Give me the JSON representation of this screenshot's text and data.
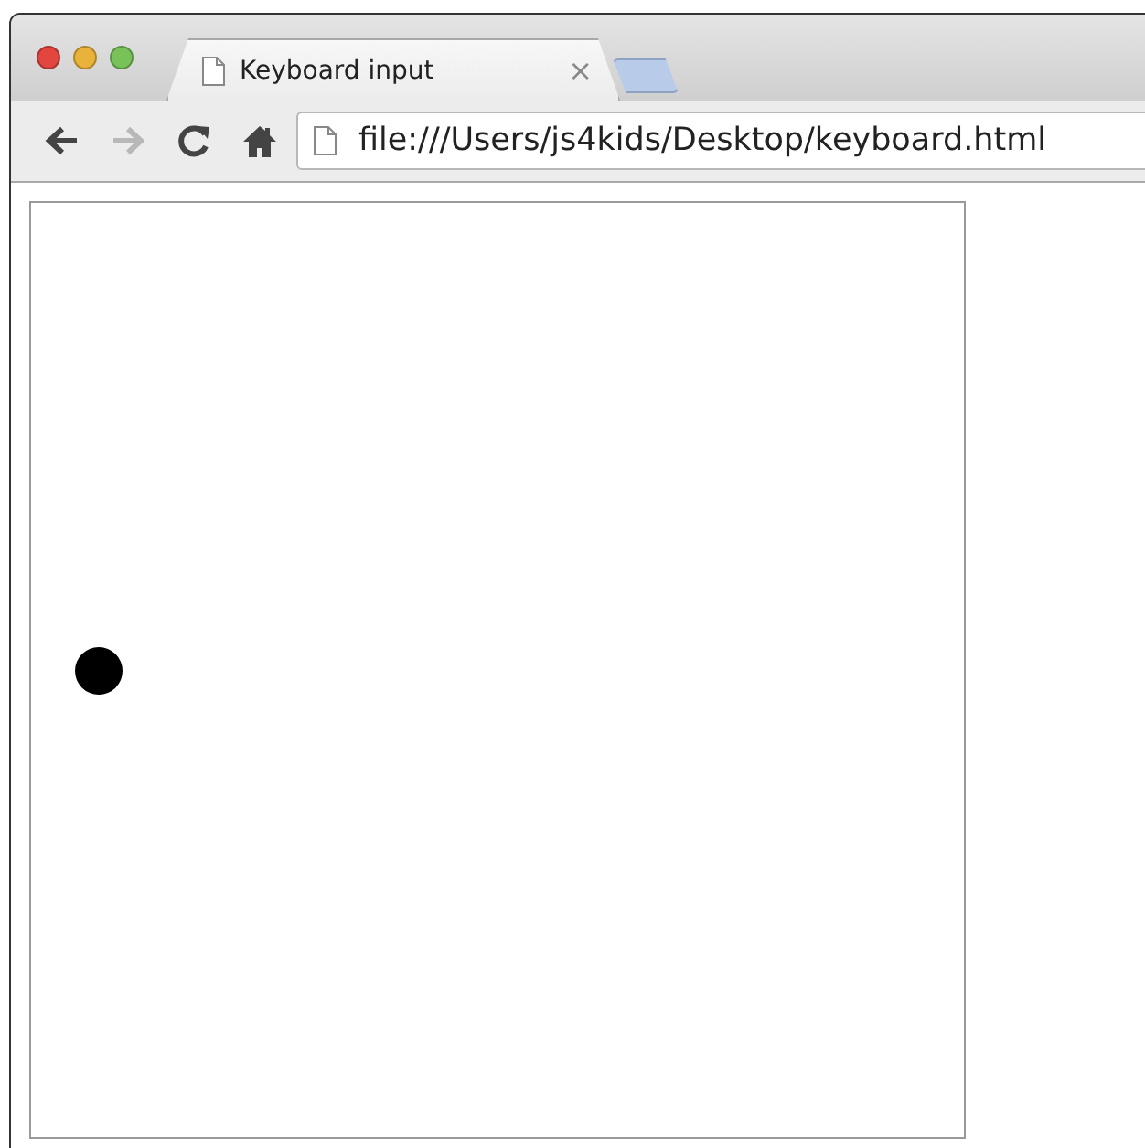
{
  "tabs": [
    {
      "title": "Keyboard input",
      "selected": true,
      "close": "×"
    }
  ],
  "toolbar": {
    "buttons": [
      {
        "kind": "back",
        "disabled": false
      },
      {
        "kind": "forward",
        "disabled": true
      },
      {
        "kind": "reload",
        "disabled": false
      },
      {
        "kind": "home",
        "disabled": false
      }
    ],
    "address": "file:///Users/js4kids/Desktop/keyboard.html"
  }
}
